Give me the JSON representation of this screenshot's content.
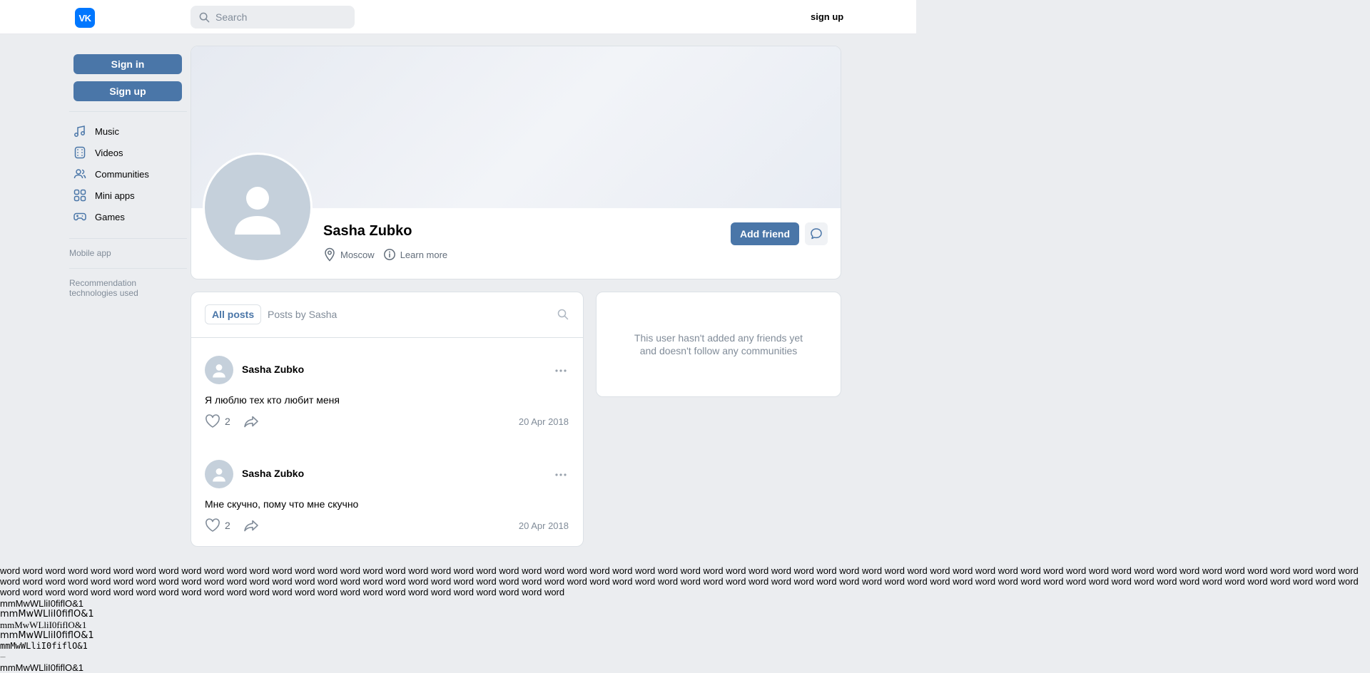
{
  "header": {
    "logo_text": "VK",
    "search_placeholder": "Search",
    "signup_label": "sign up"
  },
  "sidebar": {
    "signin_label": "Sign in",
    "signup_label": "Sign up",
    "items": [
      {
        "label": "Music",
        "icon": "music-icon"
      },
      {
        "label": "Videos",
        "icon": "video-icon"
      },
      {
        "label": "Communities",
        "icon": "communities-icon"
      },
      {
        "label": "Mini apps",
        "icon": "mini-apps-icon"
      },
      {
        "label": "Games",
        "icon": "gamepad-icon"
      }
    ],
    "mobile_app": "Mobile app",
    "recommendation": "Recommendation technologies used"
  },
  "profile": {
    "name": "Sasha Zubko",
    "city": "Moscow",
    "learn_more": "Learn more",
    "add_friend": "Add friend"
  },
  "wall": {
    "tabs": {
      "all_posts": "All posts",
      "by_user": "Posts by Sasha"
    },
    "posts": [
      {
        "author": "Sasha Zubko",
        "text": "Я люблю тех кто любит меня",
        "likes": "2",
        "date": "20 Apr 2018"
      },
      {
        "author": "Sasha Zubko",
        "text": "Мне скучно, пому что мне скучно",
        "likes": "2",
        "date": "20 Apr 2018"
      }
    ]
  },
  "friends": {
    "empty_text": "This user hasn't added any friends yet and doesn't follow any communities"
  },
  "test_text": {
    "words": "word word word word word word word word word word word word word word word word word word word word word word word word word word word word word word word word word word word word word word word word word word word word word word word word word word word word word word word word word word word word word word word word word word word word word word word word word word word word word word word word word word word word word word word word word word word word word word word word word word word word word word word word word word word word word word word word word word word word word word word word word word word word word word word word word word word word word word word word word word word word word word word word word",
    "glyphs": "mmMwWLliI0fiflO&1",
    "dash": "—"
  },
  "colors": {
    "accent": "#4a76a8",
    "vk_blue": "#0077ff",
    "background": "#ebedf0",
    "muted_text": "#818c99"
  }
}
